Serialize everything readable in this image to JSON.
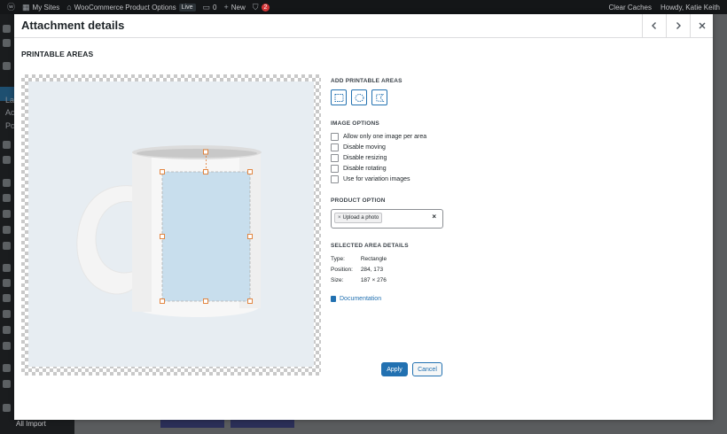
{
  "admin_bar": {
    "my_sites": "My Sites",
    "site_name": "WooCommerce Product Options",
    "live_badge": "Live",
    "comments_count": "0",
    "new_label": "New",
    "updates_count": "2",
    "clear_caches": "Clear Caches",
    "howdy": "Howdy, Katie Keith"
  },
  "sidebar": {
    "partial_items": [
      "La",
      "Ac",
      "Po"
    ],
    "all_import": "All Import"
  },
  "modal": {
    "title": "Attachment details",
    "prev_icon": "chevron-left-icon",
    "next_icon": "chevron-right-icon",
    "close_icon": "close-icon",
    "section_title": "PRINTABLE AREAS"
  },
  "panel": {
    "add_areas_label": "ADD PRINTABLE AREAS",
    "shape_buttons": [
      "rectangle-select-icon",
      "ellipse-select-icon",
      "freeform-select-icon"
    ],
    "image_options_label": "IMAGE OPTIONS",
    "options": [
      {
        "label": "Allow only one image per area",
        "checked": false
      },
      {
        "label": "Disable moving",
        "checked": false
      },
      {
        "label": "Disable resizing",
        "checked": false
      },
      {
        "label": "Disable rotating",
        "checked": false
      },
      {
        "label": "Use for variation images",
        "checked": false
      }
    ],
    "product_option_label": "PRODUCT OPTION",
    "product_option_token": "Upload a photo",
    "token_remove": "×",
    "clear_selection": "×",
    "selected_area_label": "SELECTED AREA DETAILS",
    "details": [
      {
        "key": "Type:",
        "value": "Rectangle"
      },
      {
        "key": "Position:",
        "value": "284, 173"
      },
      {
        "key": "Size:",
        "value": "187 × 276"
      }
    ],
    "documentation": "Documentation",
    "apply": "Apply",
    "cancel": "Cancel"
  },
  "colors": {
    "accent": "#2271b1",
    "handle": "#e07a2e",
    "printable_fill": "#c8deed"
  }
}
